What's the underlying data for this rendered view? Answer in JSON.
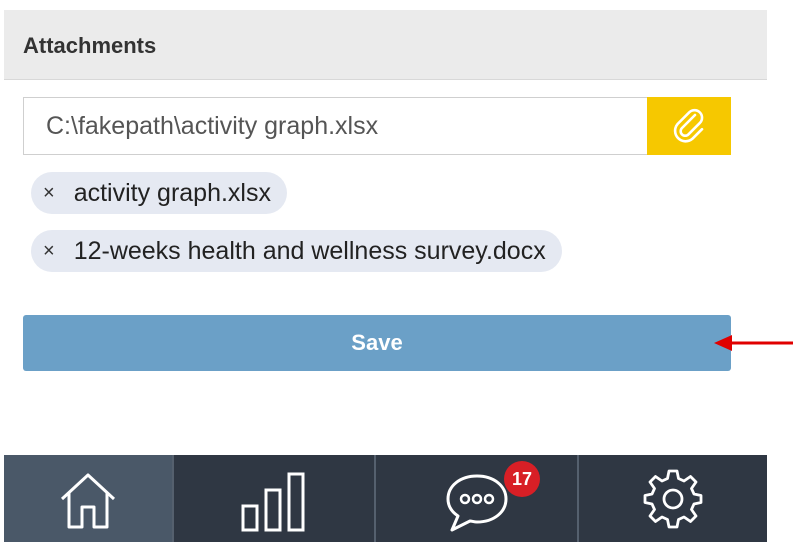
{
  "attachments": {
    "header": "Attachments",
    "file_input_value": "C:\\fakepath\\activity graph.xlsx",
    "attach_button_icon": "paperclip-icon",
    "files": [
      {
        "remove_symbol": "×",
        "name": "activity graph.xlsx"
      },
      {
        "remove_symbol": "×",
        "name": "12-weeks health and wellness survey.docx"
      }
    ],
    "save_label": "Save"
  },
  "bottom_nav": {
    "items": [
      {
        "icon": "home-icon",
        "active": true
      },
      {
        "icon": "bar-chart-icon",
        "active": false
      },
      {
        "icon": "chat-bubble-icon",
        "active": false,
        "badge": "17"
      },
      {
        "icon": "gear-icon",
        "active": false
      }
    ]
  },
  "colors": {
    "attach_button": "#f6c800",
    "save_button": "#6ba0c7",
    "badge": "#d81f26",
    "arrow": "#e00000",
    "nav_background": "#2f3743",
    "nav_active": "#4a5868"
  }
}
